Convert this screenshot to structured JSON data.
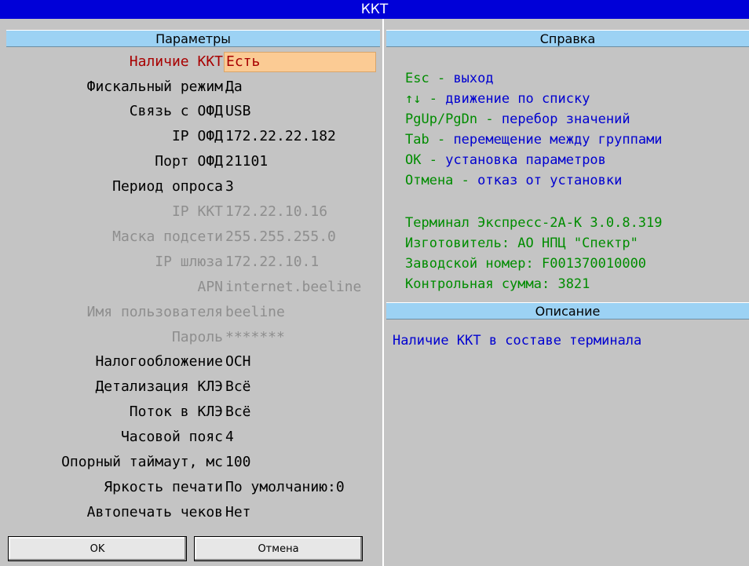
{
  "window": {
    "title": "ККТ"
  },
  "left_panel": {
    "header": "Параметры",
    "params": [
      {
        "label": "Наличие ККТ",
        "value": "Есть",
        "state": "selected"
      },
      {
        "label": "Фискальный режим",
        "value": "Да",
        "state": "normal"
      },
      {
        "label": "Связь с ОФД",
        "value": "USB",
        "state": "normal"
      },
      {
        "label": "IP ОФД",
        "value": "172.22.22.182",
        "state": "normal"
      },
      {
        "label": "Порт ОФД",
        "value": "21101",
        "state": "normal"
      },
      {
        "label": "Период опроса",
        "value": "3",
        "state": "normal"
      },
      {
        "label": "IP ККТ",
        "value": "172.22.10.16",
        "state": "disabled"
      },
      {
        "label": "Маска подсети",
        "value": "255.255.255.0",
        "state": "disabled"
      },
      {
        "label": "IP шлюза",
        "value": "172.22.10.1",
        "state": "disabled"
      },
      {
        "label": "APN",
        "value": "internet.beeline",
        "state": "disabled"
      },
      {
        "label": "Имя пользователя",
        "value": "beeline",
        "state": "disabled"
      },
      {
        "label": "Пароль",
        "value": "*******",
        "state": "disabled"
      },
      {
        "label": "Налогообложение",
        "value": "ОСН",
        "state": "normal"
      },
      {
        "label": "Детализация КЛЭ",
        "value": "Всё",
        "state": "normal"
      },
      {
        "label": "Поток в КЛЭ",
        "value": "Всё",
        "state": "normal"
      },
      {
        "label": "Часовой пояс",
        "value": "4",
        "state": "normal"
      },
      {
        "label": "Опорный таймаут, мс",
        "value": "100",
        "state": "normal"
      },
      {
        "label": "Яркость печати",
        "value": "По умолчанию:0",
        "state": "normal"
      },
      {
        "label": "Автопечать чеков",
        "value": "Нет",
        "state": "normal"
      }
    ],
    "buttons": {
      "ok": "OK",
      "cancel": "Отмена"
    }
  },
  "right_panel": {
    "help_header": "Справка",
    "help_keys": [
      {
        "key": "Esc",
        "sep": " - ",
        "desc": "выход"
      },
      {
        "key": "↑↓",
        "sep": " - ",
        "desc": "движение по списку"
      },
      {
        "key": "PgUp/PgDn",
        "sep": " - ",
        "desc": "перебор значений"
      },
      {
        "key": "Tab",
        "sep": " - ",
        "desc": "перемещение между группами"
      },
      {
        "key": "OK",
        "sep": " - ",
        "desc": "установка параметров"
      },
      {
        "key": "Отмена",
        "sep": " - ",
        "desc": "отказ от установки"
      }
    ],
    "info": [
      "Терминал Экспресс-2А-К 3.0.8.319",
      "Изготовитель: АО НПЦ \"Спектр\"",
      "Заводской номер: F001370010000",
      "Контрольная сумма: 3821"
    ],
    "desc_header": "Описание",
    "description": "Наличие ККТ в составе терминала"
  },
  "colors": {
    "titlebar": "#0000d8",
    "header": "#9cd2f4",
    "background": "#c4c4c4",
    "selected_bg": "#fbcb94",
    "selected_text": "#a80000",
    "help_key": "#008c00",
    "help_desc": "#0000d0",
    "disabled_text": "#8e8e8e"
  }
}
